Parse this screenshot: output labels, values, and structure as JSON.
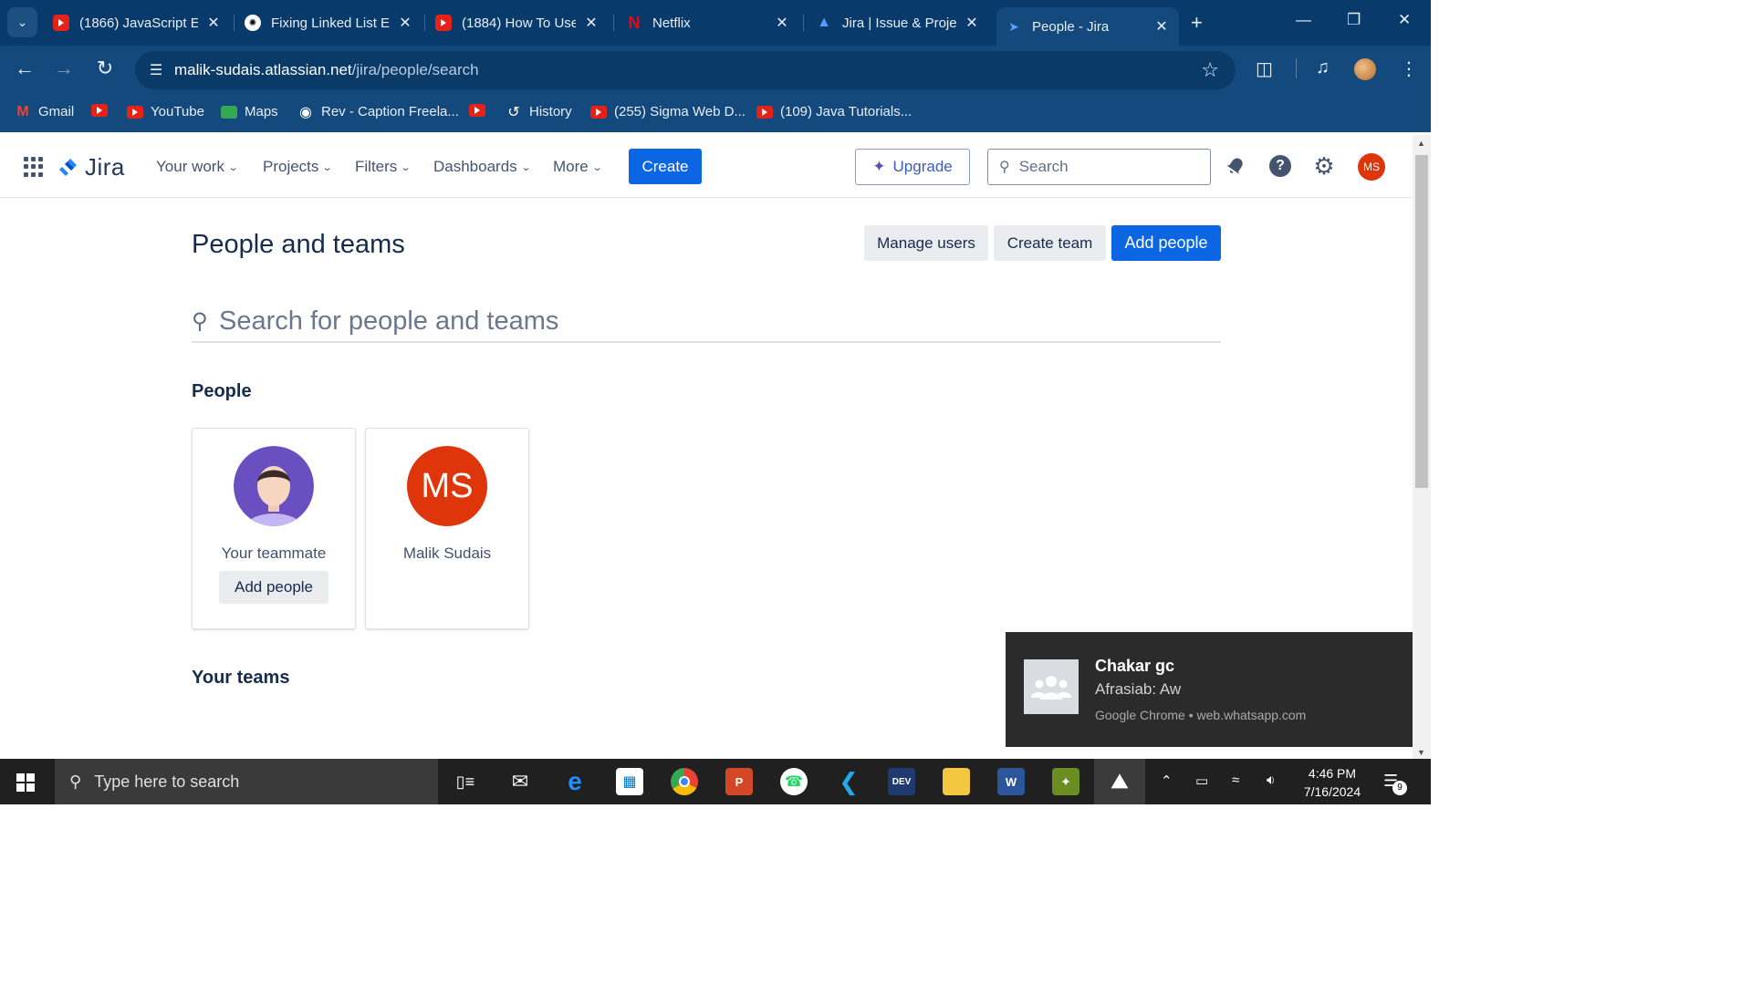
{
  "browser": {
    "tabs": [
      {
        "title": "(1866) JavaScript E",
        "favicon": "youtube-icon"
      },
      {
        "title": "Fixing Linked List E",
        "favicon": "chatgpt-icon"
      },
      {
        "title": "(1884) How To Use",
        "favicon": "youtube-icon"
      },
      {
        "title": "Netflix",
        "favicon": "netflix-icon"
      },
      {
        "title": "Jira | Issue & Proje",
        "favicon": "atlassian-icon"
      },
      {
        "title": "People - Jira",
        "favicon": "jira-icon",
        "active": true
      }
    ],
    "url_host": "malik-sudais.atlassian.net",
    "url_path": "/jira/people/search",
    "bookmarks": [
      {
        "label": "Gmail",
        "icon": "gmail-icon"
      },
      {
        "label": "",
        "icon": "youtube-icon"
      },
      {
        "label": "YouTube",
        "icon": "youtube-icon"
      },
      {
        "label": "Maps",
        "icon": "maps-icon"
      },
      {
        "label": "Rev - Caption Freela...",
        "icon": "rev-icon"
      },
      {
        "label": "",
        "icon": "youtube-icon"
      },
      {
        "label": "History",
        "icon": "history-icon"
      },
      {
        "label": "(255) Sigma Web D...",
        "icon": "youtube-icon"
      },
      {
        "label": "(109) Java Tutorials...",
        "icon": "youtube-icon"
      }
    ]
  },
  "jira": {
    "logo_text": "Jira",
    "nav": [
      "Your work",
      "Projects",
      "Filters",
      "Dashboards",
      "More"
    ],
    "create_label": "Create",
    "upgrade_label": "Upgrade",
    "search_placeholder": "Search",
    "avatar_initials": "MS"
  },
  "page": {
    "title": "People and teams",
    "manage_users": "Manage users",
    "create_team": "Create team",
    "add_people": "Add people",
    "search_placeholder": "Search for people and teams",
    "people_heading": "People",
    "teams_heading": "Your teams",
    "people": [
      {
        "name": "Your teammate",
        "action": "Add people"
      },
      {
        "name": "Malik Sudais",
        "initials": "MS"
      }
    ]
  },
  "toast": {
    "title": "Chakar gc",
    "message": "Afrasiab: Aw",
    "source": "Google Chrome • web.whatsapp.com"
  },
  "taskbar": {
    "search_placeholder": "Type here to search",
    "time": "4:46 PM",
    "date": "7/16/2024",
    "notification_count": "9"
  },
  "colors": {
    "chrome_frame": "#083a6b",
    "chrome_toolbar": "#14497d",
    "jira_blue": "#0c66e4",
    "avatar_red": "#de350b",
    "taskbar": "#202020"
  }
}
